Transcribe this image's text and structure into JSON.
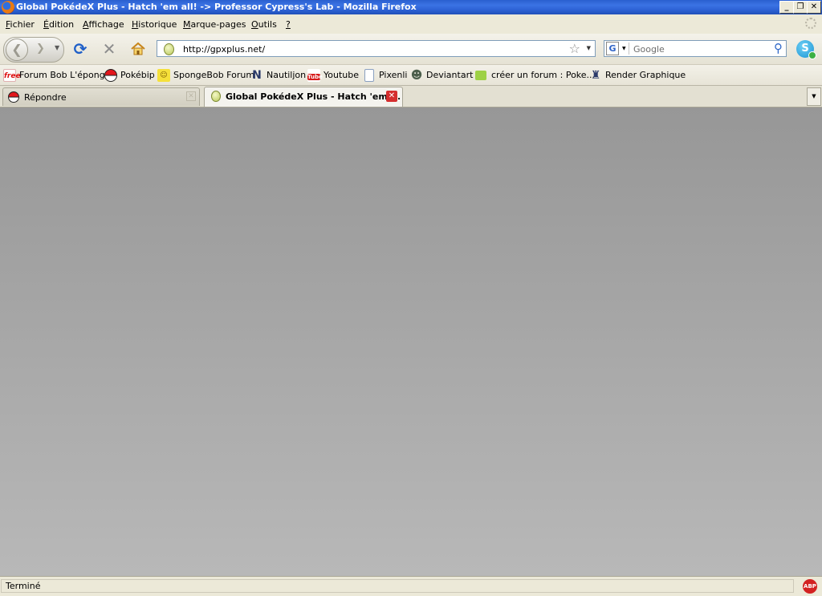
{
  "window": {
    "title": "Global PokédeX Plus - Hatch 'em all! -> Professor Cypress's Lab - Mozilla Firefox",
    "controls": {
      "minimize": "_",
      "restore": "❐",
      "close": "✕"
    }
  },
  "menu": {
    "items": [
      {
        "accesskey": "F",
        "rest": "ichier"
      },
      {
        "accesskey": "É",
        "rest": "dition"
      },
      {
        "accesskey": "A",
        "rest": "ffichage"
      },
      {
        "accesskey": "H",
        "rest": "istorique"
      },
      {
        "accesskey": "M",
        "rest": "arque-pages"
      },
      {
        "accesskey": "O",
        "rest": "utils"
      },
      {
        "accesskey": "?",
        "rest": ""
      }
    ]
  },
  "navigation": {
    "url": "http://gpxplus.net/",
    "search_placeholder": "Google",
    "search_engine_letter": "G",
    "skype_letter": "S"
  },
  "bookmarks": {
    "items": [
      {
        "label": "Forum Bob L'éponge",
        "icon": "free-icon",
        "icon_text": "free"
      },
      {
        "label": "Pokébip",
        "icon": "pokeball-icon",
        "icon_text": ""
      },
      {
        "label": "SpongeBob Forum",
        "icon": "spongebob-icon",
        "icon_text": "☺"
      },
      {
        "label": "Nautiljon",
        "icon": "nautiljon-icon",
        "icon_text": "N"
      },
      {
        "label": "Youtube",
        "icon": "youtube-icon",
        "icon_text": "Tube"
      },
      {
        "label": "Pixenli",
        "icon": "page-icon",
        "icon_text": ""
      },
      {
        "label": "Deviantart",
        "icon": "deviantart-icon",
        "icon_text": "☻"
      },
      {
        "label": "créer un forum : Poke...",
        "icon": "speech-bubble-icon",
        "icon_text": ""
      },
      {
        "label": "Render Graphique",
        "icon": "render-icon",
        "icon_text": "♜"
      }
    ]
  },
  "tabs": {
    "items": [
      {
        "label": "Répondre",
        "active": false
      },
      {
        "label": "Global PokédeX Plus - Hatch 'em ...",
        "active": true
      }
    ]
  },
  "status": {
    "text": "Terminé",
    "adblock_label": "ABP"
  },
  "colors": {
    "titlebar": "#2a5fcf",
    "chrome": "#ece9d8",
    "content_top": "#979797",
    "content_bottom": "#b8b8b8",
    "tab_close_active": "#d52e2e",
    "adblock": "#d32121"
  }
}
